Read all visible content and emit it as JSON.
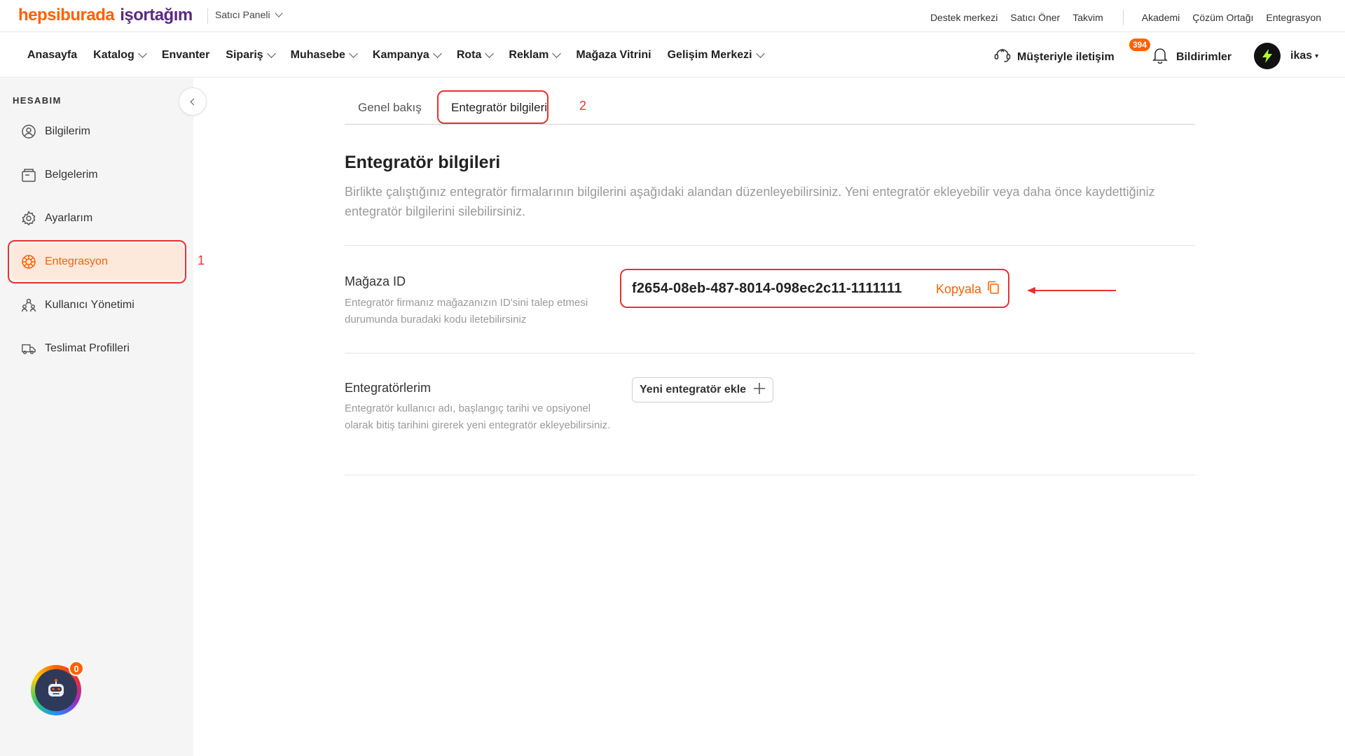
{
  "brand": {
    "hepsiburada": "hepsiburada",
    "isortagim": "işortağım",
    "accent": "#ff6000",
    "purple": "#5a2a82",
    "annotation": "#e8322e"
  },
  "topbar": {
    "panel_label": "Satıcı Paneli",
    "links_left": [
      "Destek merkezi",
      "Satıcı Öner",
      "Takvim"
    ],
    "links_right": [
      "Akademi",
      "Çözüm Ortağı",
      "Entegrasyon"
    ]
  },
  "nav": {
    "items": [
      {
        "label": "Anasayfa",
        "dropdown": false
      },
      {
        "label": "Katalog",
        "dropdown": true
      },
      {
        "label": "Envanter",
        "dropdown": false
      },
      {
        "label": "Sipariş",
        "dropdown": true
      },
      {
        "label": "Muhasebe",
        "dropdown": true
      },
      {
        "label": "Kampanya",
        "dropdown": true
      },
      {
        "label": "Rota",
        "dropdown": true
      },
      {
        "label": "Reklam",
        "dropdown": true
      },
      {
        "label": "Mağaza Vitrini",
        "dropdown": false
      },
      {
        "label": "Gelişim Merkezi",
        "dropdown": true
      }
    ],
    "contact_label": "Müşteriyle iletişim",
    "notifications_label": "Bildirimler",
    "notifications_count": "394",
    "user_label": "ikas"
  },
  "sidebar": {
    "title": "HESABIM",
    "items": [
      {
        "label": "Bilgilerim",
        "icon": "user-circle-icon"
      },
      {
        "label": "Belgelerim",
        "icon": "documents-icon"
      },
      {
        "label": "Ayarlarım",
        "icon": "gear-icon"
      },
      {
        "label": "Entegrasyon",
        "icon": "integration-icon",
        "active": true
      },
      {
        "label": "Kullanıcı Yönetimi",
        "icon": "users-icon"
      },
      {
        "label": "Teslimat Profilleri",
        "icon": "truck-icon"
      }
    ],
    "chat_badge": "0"
  },
  "annotations": {
    "step1": "1",
    "step2": "2"
  },
  "main": {
    "tabs": [
      "Genel bakış",
      "Entegratör bilgileri"
    ],
    "title": "Entegratör bilgileri",
    "description": "Birlikte çalıştığınız entegratör firmalarının bilgilerini aşağıdaki alandan düzenleyebilirsiniz. Yeni entegratör ekleyebilir veya daha önce kaydettiğiniz entegratör bilgilerini silebilirsiniz.",
    "store_id": {
      "label": "Mağaza ID",
      "help": "Entegratör firmanız mağazanızın ID'sini talep etmesi durumunda buradaki kodu iletebilirsiniz",
      "value": "f2654-08eb-487-8014-098ec2c11-1111111",
      "copy_label": "Kopyala"
    },
    "integrators": {
      "label": "Entegratörlerim",
      "help": "Entegratör kullanıcı adı, başlangıç tarihi ve opsiyonel olarak bitiş tarihini girerek yeni entegratör ekleyebilirsiniz.",
      "add_label": "Yeni entegratör ekle"
    }
  }
}
